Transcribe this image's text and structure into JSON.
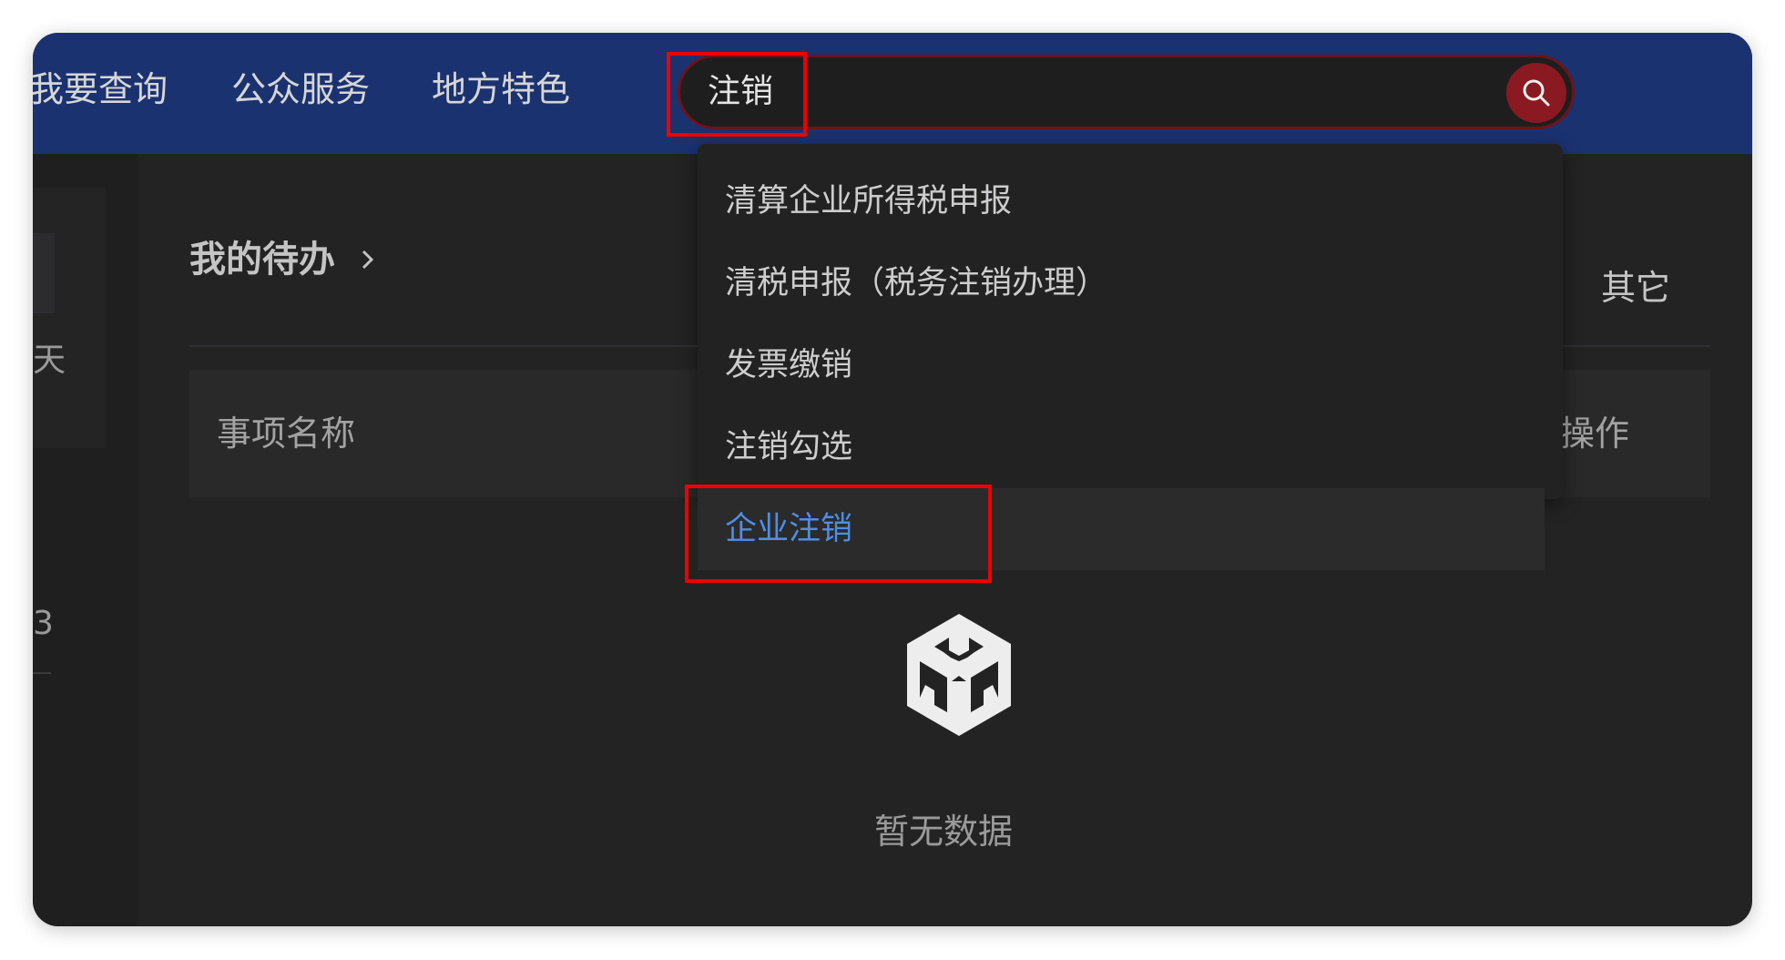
{
  "nav": {
    "items": [
      {
        "label": "我要查询"
      },
      {
        "label": "公众服务"
      },
      {
        "label": "地方特色"
      }
    ]
  },
  "search": {
    "value": "注销",
    "button_icon": "search-icon",
    "suggestions": [
      {
        "label": "清算企业所得税申报"
      },
      {
        "label": "清税申报（税务注销办理）"
      },
      {
        "label": "发票缴销"
      },
      {
        "label": "注销勾选"
      },
      {
        "label": "企业注销"
      }
    ],
    "active_suggestion": "企业注销"
  },
  "left": {
    "text_1": "天",
    "text_2": "3"
  },
  "todo": {
    "title": "我的待办",
    "title_icon": "chevron-right-icon",
    "other_label": "其它",
    "columns": [
      {
        "label": "事项名称"
      },
      {
        "label": "操作"
      }
    ],
    "empty_icon": "empty-box-icon",
    "empty_text": "暂无数据"
  },
  "colors": {
    "topbar": "#1b3271",
    "background": "#232324",
    "accent_red": "#8a1921",
    "highlight": "#ef0000",
    "active_link": "#4f8de6"
  }
}
